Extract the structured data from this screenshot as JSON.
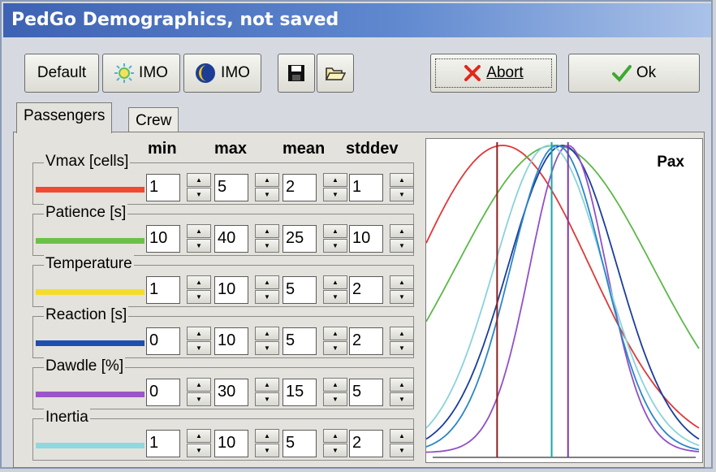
{
  "window": {
    "title": "PedGo Demographics, not saved"
  },
  "toolbar": {
    "default_label": "Default",
    "imo_day_label": "IMO",
    "imo_night_label": "IMO",
    "abort_label": "Abort",
    "ok_label": "Ok"
  },
  "tabs": [
    {
      "label": "Passengers"
    },
    {
      "label": "Crew"
    }
  ],
  "columns": {
    "min": "min",
    "max": "max",
    "mean": "mean",
    "stddev": "stddev"
  },
  "params": [
    {
      "label": "Vmax [cells]",
      "color": "#f04a33",
      "min": "1",
      "max": "5",
      "mean": "2",
      "stddev": "1"
    },
    {
      "label": "Patience [s]",
      "color": "#6cc04a",
      "min": "10",
      "max": "40",
      "mean": "25",
      "stddev": "10"
    },
    {
      "label": "Temperature",
      "color": "#f5dc2a",
      "min": "1",
      "max": "10",
      "mean": "5",
      "stddev": "2"
    },
    {
      "label": "Reaction [s]",
      "color": "#1e4fb0",
      "min": "0",
      "max": "10",
      "mean": "5",
      "stddev": "2"
    },
    {
      "label": "Dawdle [%]",
      "color": "#9a55c8",
      "min": "0",
      "max": "30",
      "mean": "15",
      "stddev": "5"
    },
    {
      "label": "Inertia",
      "color": "#8fd8e0",
      "min": "1",
      "max": "10",
      "mean": "5",
      "stddev": "2"
    }
  ],
  "chart_data": {
    "type": "line",
    "title": "Pax",
    "series_colors": [
      "#e03838",
      "#5cb848",
      "#1a3d9c",
      "#9150c4",
      "#8ad2dc",
      "#2a86c8"
    ],
    "vline_colors": [
      "#8a2020",
      "#1aa6a6",
      "#7b3aa8"
    ]
  }
}
